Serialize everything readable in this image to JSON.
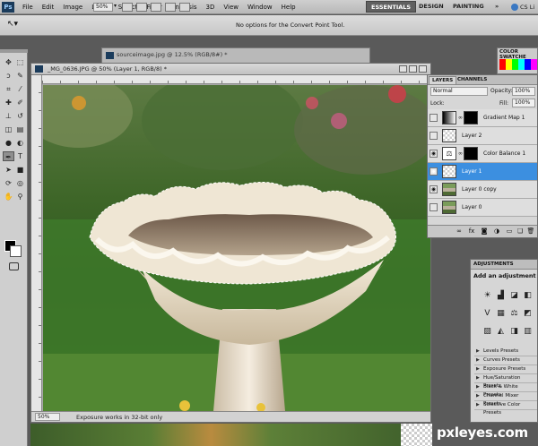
{
  "app": {
    "logo": "Ps",
    "zoom": "50%"
  },
  "menu": [
    "File",
    "Edit",
    "Image",
    "Layer",
    "Select",
    "Filter",
    "Analysis",
    "3D",
    "View",
    "Window",
    "Help"
  ],
  "workspaces": {
    "essentials": "ESSENTIALS",
    "design": "DESIGN",
    "painting": "PAINTING",
    "more": "»",
    "cs_live": "CS Li"
  },
  "options_bar": {
    "message": "No options for the Convert Point Tool."
  },
  "background_doc": {
    "title": "sourceimage.jpg @ 12.5% (RGB/8#) *"
  },
  "document": {
    "title": "_MG_0636.JPG @ 50% (Layer 1, RGB/8) *",
    "status_zoom": "50%",
    "status_text": "Exposure works in 32-bit only"
  },
  "color_panel": {
    "tab": "COLOR   SWATCHE"
  },
  "layers_panel": {
    "tabs": [
      "LAYERS",
      "CHANNELS"
    ],
    "blend_mode": "Normal",
    "opacity_label": "Opacity:",
    "opacity": "100%",
    "lock_label": "Lock:",
    "fill_label": "Fill:",
    "fill": "100%",
    "layers": [
      {
        "name": "Gradient Map 1",
        "visible": false,
        "selected": false
      },
      {
        "name": "Layer 2",
        "visible": false,
        "selected": false
      },
      {
        "name": "Color Balance 1",
        "visible": true,
        "selected": false
      },
      {
        "name": "Layer 1",
        "visible": true,
        "selected": true
      },
      {
        "name": "Layer 0 copy",
        "visible": true,
        "selected": false
      },
      {
        "name": "Layer 0",
        "visible": false,
        "selected": false
      }
    ]
  },
  "adjustments_panel": {
    "tab": "ADJUSTMENTS",
    "title": "Add an adjustment",
    "presets": [
      "Levels Presets",
      "Curves Presets",
      "Exposure Presets",
      "Hue/Saturation Presets",
      "Black & White Presets",
      "Channel Mixer Presets",
      "Selective Color Presets"
    ]
  },
  "watermark": "pxleyes.com",
  "colors": {
    "selection": "#3c8fe0",
    "panel": "#d6d6d6",
    "chrome": "#5a5a5a"
  }
}
